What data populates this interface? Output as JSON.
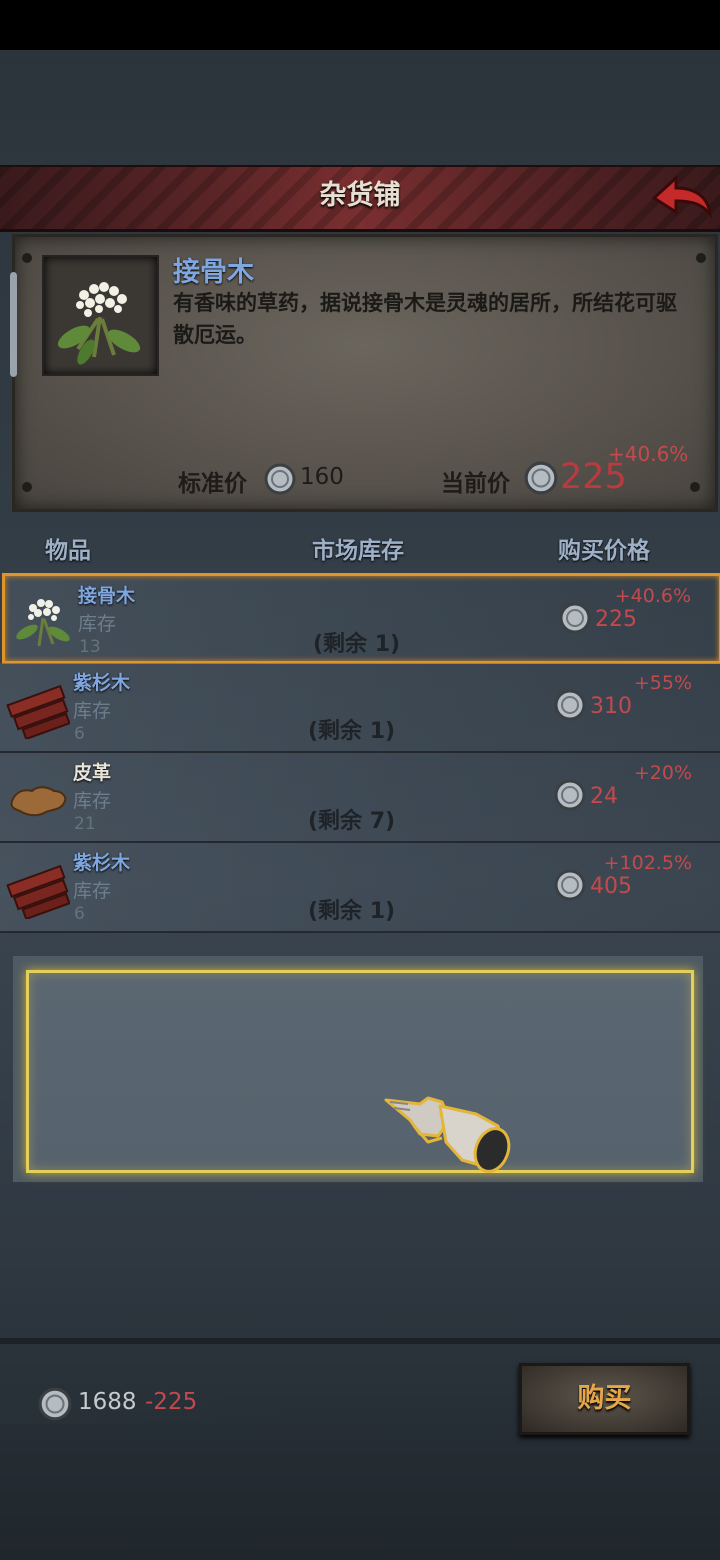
{
  "shop": {
    "title": "杂货铺"
  },
  "detail": {
    "name": "接骨木",
    "description": "有香味的草药，据说接骨木是灵魂的居所，所结花可驱散厄运。",
    "standard_price_label": "标准价",
    "standard_price": "160",
    "current_price_label": "当前价",
    "current_price": "225",
    "current_change": "+40.6%"
  },
  "table": {
    "headers": {
      "item": "物品",
      "stock": "市场库存",
      "price": "购买价格"
    },
    "stock_label": "库存",
    "rows": [
      {
        "name": "接骨木",
        "name_color": "#7fa6df",
        "stock": "13",
        "remain": "(剩余 1)",
        "price": "225",
        "change": "+40.6%",
        "icon": "elderflower-icon",
        "selected": true
      },
      {
        "name": "紫杉木",
        "name_color": "#7fa6df",
        "stock": "6",
        "remain": "(剩余 1)",
        "price": "310",
        "change": "+55%",
        "icon": "yew-wood-icon",
        "selected": false
      },
      {
        "name": "皮革",
        "name_color": "#e8e4da",
        "stock": "21",
        "remain": "(剩余 7)",
        "price": "24",
        "change": "+20%",
        "icon": "leather-icon",
        "selected": false
      },
      {
        "name": "紫杉木",
        "name_color": "#7fa6df",
        "stock": "6",
        "remain": "(剩余 1)",
        "price": "405",
        "change": "+102.5%",
        "icon": "yew-wood-icon",
        "selected": false
      }
    ]
  },
  "footer": {
    "balance": "1688",
    "cost": "-225",
    "buy_label": "购买"
  },
  "colors": {
    "accent_red": "#c14a4e",
    "highlight_gold": "#e3cf5a",
    "selection_orange": "#e0952a"
  }
}
